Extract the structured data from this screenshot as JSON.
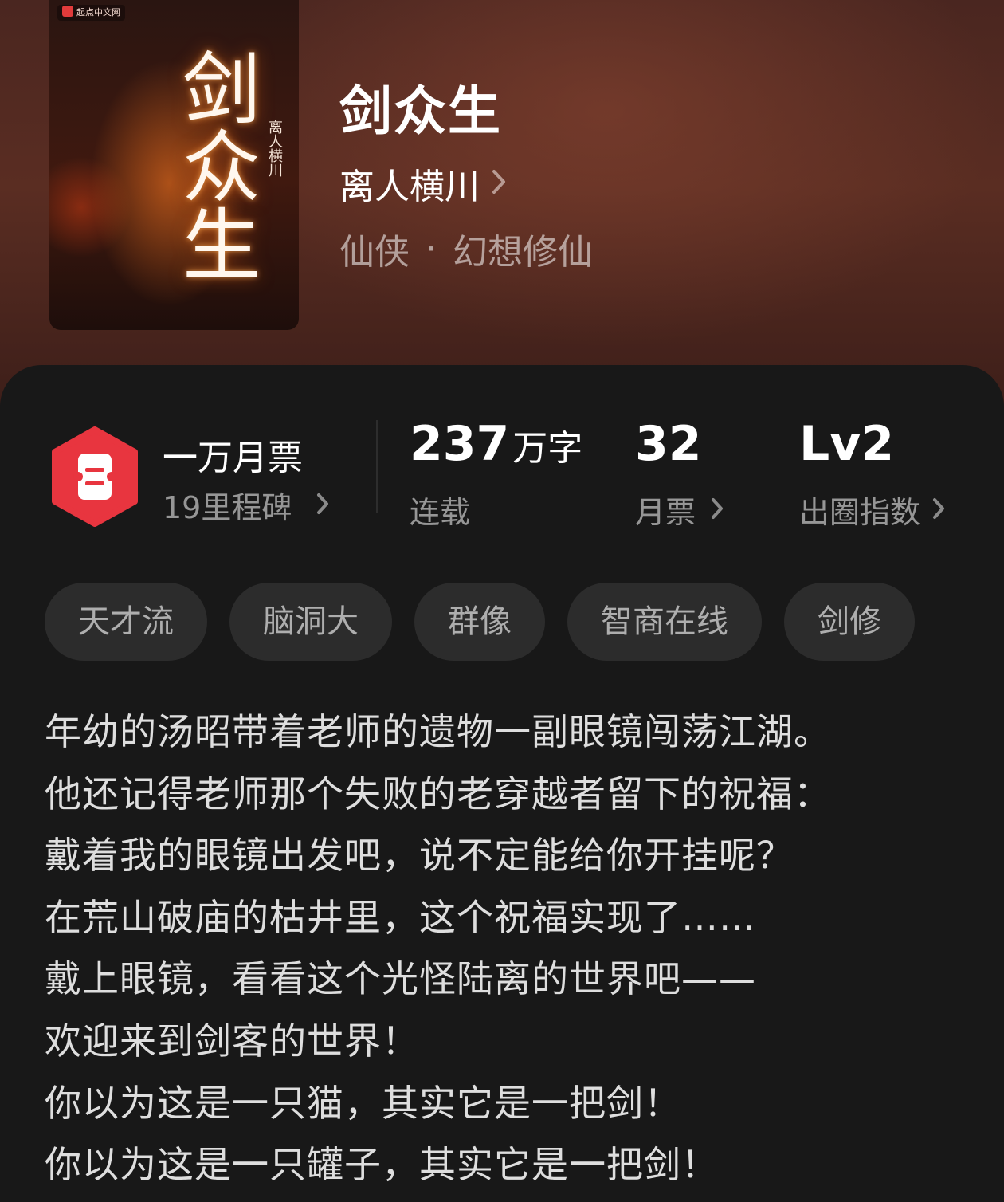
{
  "book": {
    "title": "剑众生",
    "author": "离人横川",
    "genre": "仙侠",
    "subgenre": "幻想修仙",
    "genre_separator": "·"
  },
  "cover": {
    "publisher_logo": "起点中文网",
    "title_art": "剑众生",
    "author_art": "离人横川"
  },
  "stats": {
    "monthly_badge_label": "一万月票",
    "milestones": "19里程碑",
    "word_count_value": "237",
    "word_count_unit": "万字",
    "status": "连载",
    "monthly_votes_value": "32",
    "monthly_votes_label": "月票",
    "breakout_value": "Lv2",
    "breakout_label": "出圈指数"
  },
  "tags": [
    "天才流",
    "脑洞大",
    "群像",
    "智商在线",
    "剑修"
  ],
  "intro": [
    "年幼的汤昭带着老师的遗物一副眼镜闯荡江湖。",
    "他还记得老师那个失败的老穿越者留下的祝福：",
    "戴着我的眼镜出发吧，说不定能给你开挂呢？",
    "在荒山破庙的枯井里，这个祝福实现了……",
    "戴上眼镜，看看这个光怪陆离的世界吧——",
    "欢迎来到剑客的世界！",
    "你以为这是一只猫，其实它是一把剑！",
    "你以为这是一只罐子，其实它是一把剑！"
  ],
  "icons": {
    "badge": "ticket-badge-icon",
    "chevron": "chevron-right-icon"
  },
  "colors": {
    "badge_red": "#e8353f",
    "panel_bg": "#181818",
    "tag_bg": "#2c2c2c"
  }
}
